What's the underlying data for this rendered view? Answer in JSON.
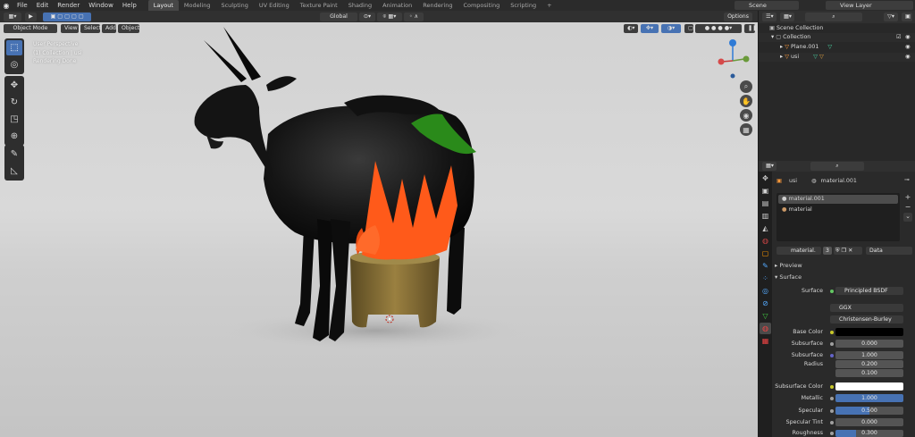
{
  "menu": {
    "items": [
      "File",
      "Edit",
      "Render",
      "Window",
      "Help"
    ]
  },
  "workspaces": {
    "tabs": [
      "Layout",
      "Modeling",
      "Sculpting",
      "UV Editing",
      "Texture Paint",
      "Shading",
      "Animation",
      "Rendering",
      "Compositing",
      "Scripting"
    ],
    "active": "Layout",
    "add": "+"
  },
  "scene": {
    "name": "Scene",
    "view_layer": "View Layer"
  },
  "viewport_header": {
    "mode": "Object Mode",
    "menus": [
      "View",
      "Select",
      "Add",
      "Object"
    ],
    "orientation": "Global",
    "options": "Options"
  },
  "viewport_overlay": {
    "view": "User Perspective",
    "collection": "(1) Collection | usi",
    "status": "Rendering Done"
  },
  "outliner": {
    "root": "Scene Collection",
    "collection": "Collection",
    "objects": [
      "Plane.001",
      "usi"
    ]
  },
  "properties": {
    "object_name": "usi",
    "material_name": "material.001",
    "slots": [
      "material.001",
      "material"
    ],
    "material_field": "material.",
    "user_count": "3",
    "link": "Data",
    "panel_preview": "Preview",
    "panel_surface": "Surface",
    "surface": {
      "label": "Surface",
      "value": "Principled BSDF"
    },
    "distribution": "GGX",
    "subsurface_method": "Christensen-Burley",
    "base_color": {
      "label": "Base Color",
      "color": "#000000"
    },
    "subsurface": {
      "label": "Subsurface",
      "value": "0.000"
    },
    "subsurface_radius": {
      "label": "Subsurface Radius",
      "values": [
        "1.000",
        "0.200",
        "0.100"
      ]
    },
    "subsurface_color": {
      "label": "Subsurface Color",
      "color": "#ffffff"
    },
    "metallic": {
      "label": "Metallic",
      "value": "1.000"
    },
    "specular": {
      "label": "Specular",
      "value": "0.500"
    },
    "specular_tint": {
      "label": "Specular Tint",
      "value": "0.000"
    },
    "roughness": {
      "label": "Roughness",
      "value": "0.300"
    }
  },
  "colors": {
    "accent": "#4772b3",
    "header": "#303030",
    "panel": "#2a2a2a",
    "flame": "#ff5a1a",
    "leaf": "#2a8a1a",
    "stump": "#8a7038"
  },
  "icons": [
    "blender-logo-icon",
    "select-box-icon",
    "cursor-icon",
    "move-icon",
    "rotate-icon",
    "scale-icon",
    "transform-icon",
    "annotate-icon",
    "measure-icon",
    "zoom-icon",
    "hand-icon",
    "camera-icon",
    "grid-icon",
    "eye-icon",
    "filter-icon",
    "search-icon",
    "pin-icon"
  ]
}
